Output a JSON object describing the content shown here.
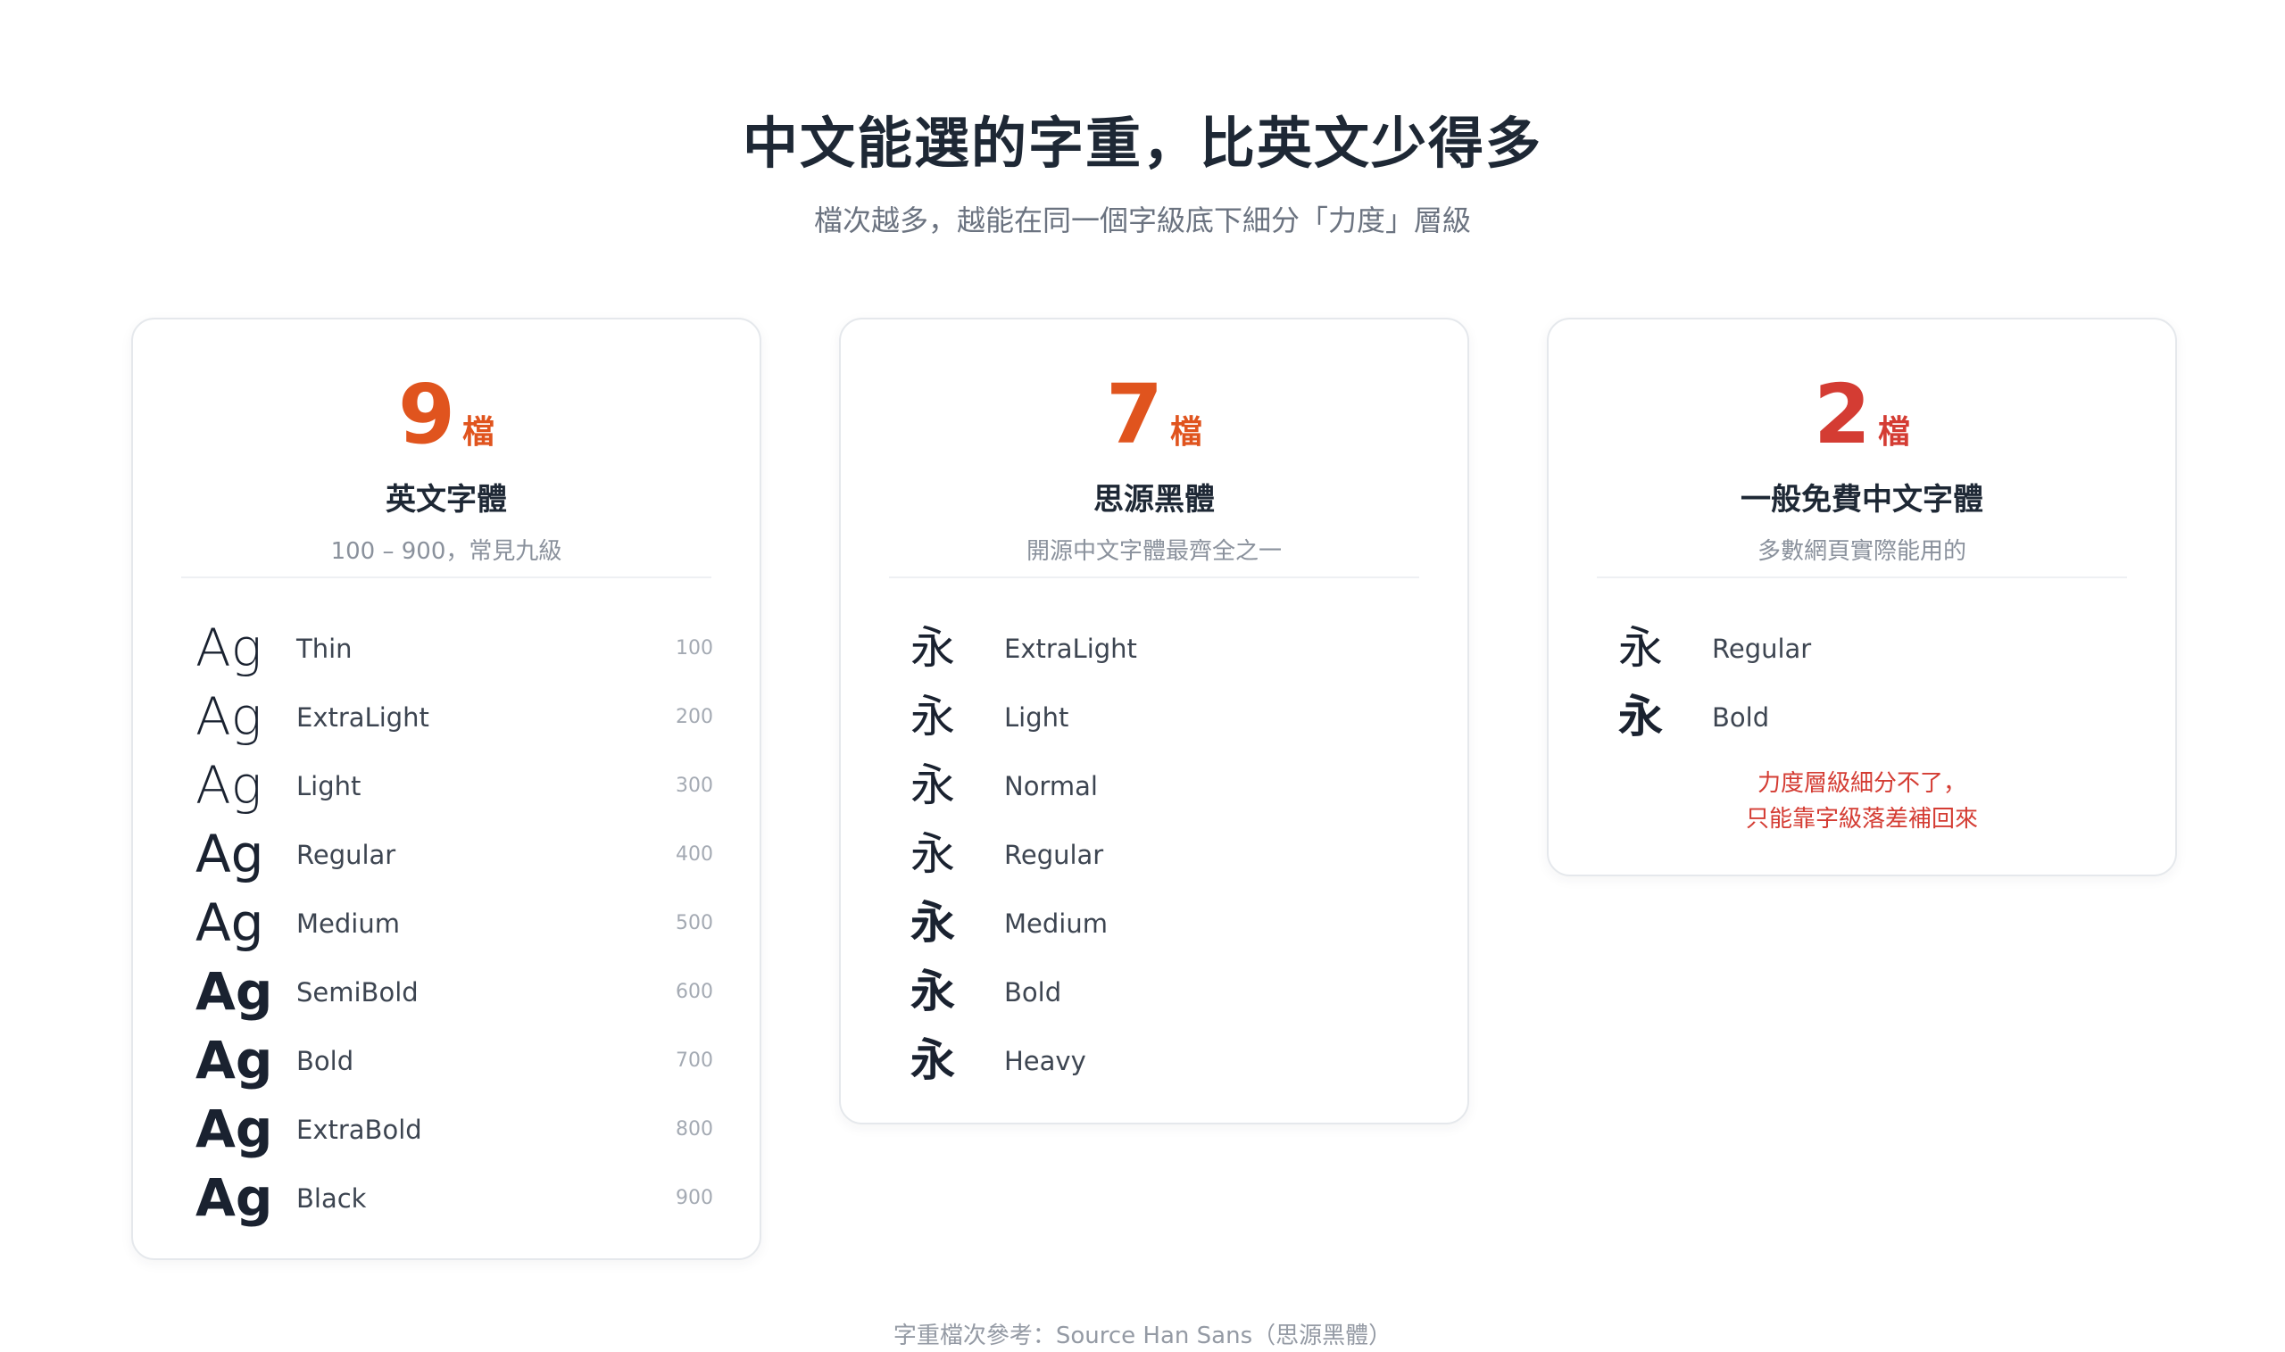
{
  "header": {
    "title": "中文能選的字重，比英文少得多",
    "subtitle": "檔次越多，越能在同一個字級底下細分「力度」層級"
  },
  "cards": [
    {
      "count": "9",
      "unit": "檔",
      "name": "英文字體",
      "desc": "100 – 900，常見九級",
      "weights": [
        {
          "sample": "Ag",
          "label": "Thin",
          "value": "100"
        },
        {
          "sample": "Ag",
          "label": "ExtraLight",
          "value": "200"
        },
        {
          "sample": "Ag",
          "label": "Light",
          "value": "300"
        },
        {
          "sample": "Ag",
          "label": "Regular",
          "value": "400"
        },
        {
          "sample": "Ag",
          "label": "Medium",
          "value": "500"
        },
        {
          "sample": "Ag",
          "label": "SemiBold",
          "value": "600"
        },
        {
          "sample": "Ag",
          "label": "Bold",
          "value": "700"
        },
        {
          "sample": "Ag",
          "label": "ExtraBold",
          "value": "800"
        },
        {
          "sample": "Ag",
          "label": "Black",
          "value": "900"
        }
      ]
    },
    {
      "count": "7",
      "unit": "檔",
      "name": "思源黑體",
      "desc": "開源中文字體最齊全之一",
      "weights": [
        {
          "sample": "永",
          "label": "ExtraLight"
        },
        {
          "sample": "永",
          "label": "Light"
        },
        {
          "sample": "永",
          "label": "Normal"
        },
        {
          "sample": "永",
          "label": "Regular"
        },
        {
          "sample": "永",
          "label": "Medium"
        },
        {
          "sample": "永",
          "label": "Bold"
        },
        {
          "sample": "永",
          "label": "Heavy"
        }
      ]
    },
    {
      "count": "2",
      "unit": "檔",
      "name": "一般免費中文字體",
      "desc": "多數網頁實際能用的",
      "weights": [
        {
          "sample": "永",
          "label": "Regular"
        },
        {
          "sample": "永",
          "label": "Bold"
        }
      ],
      "note_line1": "力度層級細分不了，",
      "note_line2": "只能靠字級落差補回來"
    }
  ],
  "footer": "字重檔次參考：Source Han Sans（思源黑體）",
  "colors": {
    "accent_orange": "#e0541e",
    "accent_red": "#d43c33",
    "text_dark": "#1e2835",
    "text_muted": "#8a919c"
  }
}
